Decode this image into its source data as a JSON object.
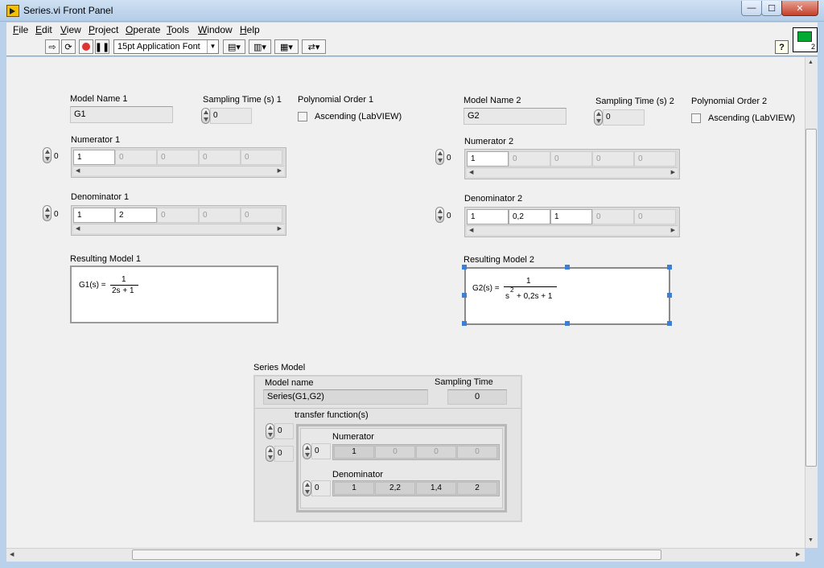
{
  "window": {
    "title": "Series.vi Front Panel",
    "buttons": {
      "minimize": "—",
      "maximize": "☐",
      "close": "✕"
    }
  },
  "menu": [
    "File",
    "Edit",
    "View",
    "Project",
    "Operate",
    "Tools",
    "Window",
    "Help"
  ],
  "toolbar": {
    "run_icon": "run-arrow-icon",
    "run_continuously_icon": "run-continuously-icon",
    "abort_icon": "abort-icon",
    "pause_icon": "pause-icon",
    "font": "15pt Application Font",
    "align_icon": "align-objects-icon",
    "distribute_icon": "distribute-objects-icon",
    "resize_icon": "resize-objects-icon",
    "reorder_icon": "reorder-icon",
    "help_label": "?",
    "vi_icon_number": "2"
  },
  "model1": {
    "name_label": "Model Name 1",
    "name": "G1",
    "sampling_label": "Sampling Time (s) 1",
    "sampling_value": "0",
    "poly_label": "Polynomial Order 1",
    "ascending_label": "Ascending (LabVIEW)",
    "numerator_label": "Numerator 1",
    "numerator_index": "0",
    "numerator": [
      "1",
      "0",
      "0",
      "0",
      "0"
    ],
    "denominator_label": "Denominator 1",
    "denominator_index": "0",
    "denominator": [
      "1",
      "2",
      "0",
      "0",
      "0"
    ],
    "result_label": "Resulting Model 1",
    "result_lhs": "G1(s) =",
    "result_num": "1",
    "result_den": "2s + 1"
  },
  "model2": {
    "name_label": "Model Name 2",
    "name": "G2",
    "sampling_label": "Sampling Time (s) 2",
    "sampling_value": "0",
    "poly_label": "Polynomial Order 2",
    "ascending_label": "Ascending (LabVIEW)",
    "numerator_label": "Numerator 2",
    "numerator_index": "0",
    "numerator": [
      "1",
      "0",
      "0",
      "0",
      "0"
    ],
    "denominator_label": "Denominator 2",
    "denominator_index": "0",
    "denominator": [
      "1",
      "0,2",
      "1",
      "0",
      "0"
    ],
    "result_label": "Resulting Model 2",
    "result_lhs": "G2(s) =",
    "result_num": "1",
    "result_den_s": "s",
    "result_den_exp": "2",
    "result_den_rest": "+ 0,2s + 1"
  },
  "series": {
    "label": "Series Model",
    "model_name_label": "Model name",
    "model_name": "Series(G1,G2)",
    "sampling_label": "Sampling Time",
    "sampling_value": "0",
    "tf_label": "transfer function(s)",
    "tf_index1": "0",
    "tf_index2": "0",
    "numerator_label": "Numerator",
    "numerator_index": "0",
    "numerator": [
      "1",
      "0",
      "0",
      "0"
    ],
    "denominator_label": "Denominator",
    "denominator_index": "0",
    "denominator": [
      "1",
      "2,2",
      "1,4",
      "2"
    ]
  }
}
